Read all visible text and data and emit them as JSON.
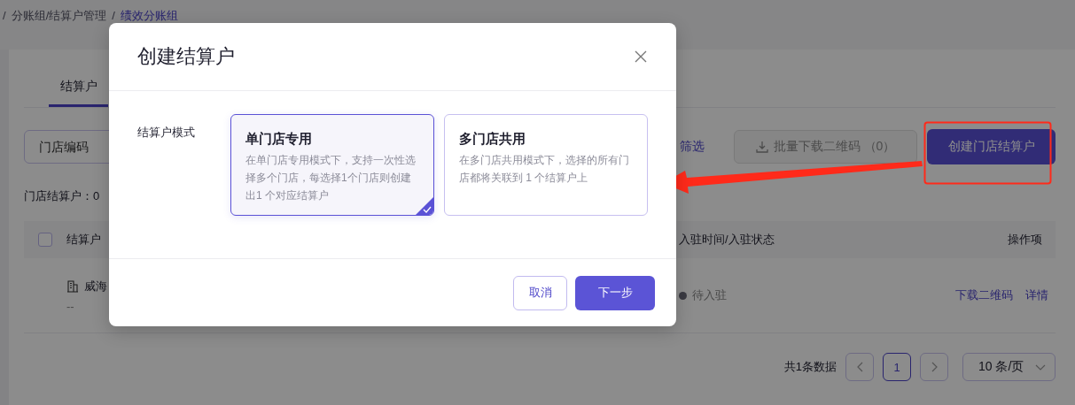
{
  "breadcrumb": {
    "separator": "/",
    "items": [
      {
        "label": "分账组/结算户管理",
        "current": false
      },
      {
        "label": "绩效分账组",
        "current": true
      }
    ]
  },
  "tabs": [
    {
      "label": "结算户",
      "selected": true
    }
  ],
  "toolbar": {
    "store_code": {
      "placeholder": "门店编码"
    },
    "filter_link": "筛选",
    "batch_download": {
      "label": "批量下载二维码 （0）",
      "disabled": true
    },
    "create": {
      "label": "创建门店结算户"
    }
  },
  "summary": "门店结算户：0",
  "table": {
    "header_checked": false,
    "columns": [
      "结算户",
      "入驻时间/入驻状态",
      "操作项"
    ],
    "rows": [
      {
        "name": "威海",
        "sub": "--",
        "status": {
          "label": "待入驻"
        },
        "actions": [
          "下载二维码",
          "详情"
        ]
      }
    ]
  },
  "pagination": {
    "total": "共1条数据",
    "pages": [
      {
        "label": "1",
        "selected": true
      }
    ],
    "page_size": "10 条/页"
  },
  "modal": {
    "title": "创建结算户",
    "field_label": "结算户模式",
    "options": [
      {
        "title": "单门店专用",
        "description": "在单门店专用模式下，支持一次性选择多个门店，每选择1个门店则创建出1 个对应结算户",
        "selected": true
      },
      {
        "title": "多门店共用",
        "description": "在多门店共用模式下，选择的所有门店都将关联到 1 个结算户上",
        "selected": false
      }
    ],
    "cancel": "取消",
    "next": "下一步"
  }
}
